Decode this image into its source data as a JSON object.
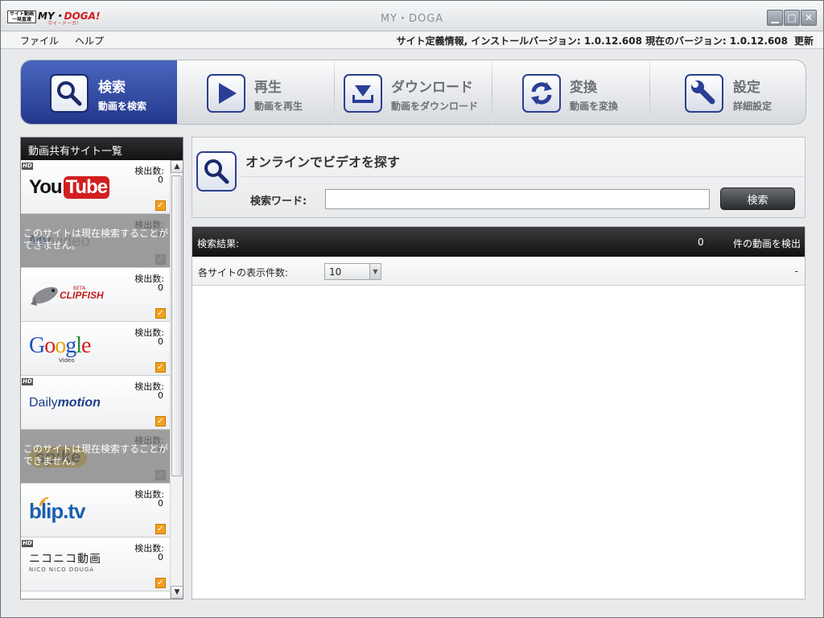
{
  "window": {
    "title": "MY・DOGA",
    "logo_small": "サイト動画\n一発直速",
    "logo_main_1": "MY・",
    "logo_main_2": "DOGA!",
    "logo_sub": "マイ・ドーガ！"
  },
  "menubar": {
    "file": "ファイル",
    "help": "ヘルプ",
    "info": "サイト定義情報, インストールバージョン: 1.0.12.608 現在のバージョン: 1.0.12.608",
    "update": "更新"
  },
  "nav": {
    "items": [
      {
        "label": "検索",
        "sub": "動画を検索",
        "icon": "search-icon",
        "active": true
      },
      {
        "label": "再生",
        "sub": "動画を再生",
        "icon": "play-icon",
        "active": false
      },
      {
        "label": "ダウンロード",
        "sub": "動画をダウンロード",
        "icon": "download-icon",
        "active": false
      },
      {
        "label": "変換",
        "sub": "動画を変換",
        "icon": "convert-icon",
        "active": false
      },
      {
        "label": "設定",
        "sub": "詳細設定",
        "icon": "wrench-icon",
        "active": false
      }
    ]
  },
  "sidebar": {
    "title": "動画共有サイト一覧",
    "count_label": "検出数:",
    "disabled_text": "このサイトは現在検索することができません。",
    "sites": [
      {
        "name": "YouTube",
        "hd": true,
        "count": "0",
        "enabled": true,
        "logo_a": "You",
        "logo_b": "Tube"
      },
      {
        "name": "MyVideo",
        "hd": false,
        "count": "0",
        "enabled": false,
        "logo_a": "My",
        "logo_b": "video"
      },
      {
        "name": "CLIPFISH",
        "hd": false,
        "count": "0",
        "enabled": true,
        "logo_a": "CLIPFISH",
        "logo_b": "BETA"
      },
      {
        "name": "Google Video",
        "hd": false,
        "count": "0",
        "enabled": true,
        "logo_a": "Google",
        "logo_b": "Video"
      },
      {
        "name": "Dailymotion",
        "hd": true,
        "count": "0",
        "enabled": true,
        "logo_a": "Daily",
        "logo_b": "motion"
      },
      {
        "name": "Spike",
        "hd": false,
        "count": "0",
        "enabled": false,
        "logo_a": "spike",
        "logo_b": ""
      },
      {
        "name": "blip.tv",
        "hd": false,
        "count": "0",
        "enabled": true,
        "logo_a": "blip.tv",
        "logo_b": ""
      },
      {
        "name": "ニコニコ動画",
        "hd": true,
        "count": "0",
        "enabled": true,
        "logo_a": "ニコニコ動画",
        "logo_b": "NICO NICO DOUGA"
      }
    ]
  },
  "search": {
    "title": "オンラインでビデオを探す",
    "keyword_label": "検索ワード:",
    "keyword_value": "",
    "button": "検索"
  },
  "results": {
    "label": "検索結果:",
    "count": "0",
    "suffix": "件の動画を検出",
    "per_site_label": "各サイトの表示件数:",
    "per_site_value": "10",
    "pager": "-"
  },
  "colors": {
    "accent": "#2a3e95",
    "check": "#f3a021"
  }
}
